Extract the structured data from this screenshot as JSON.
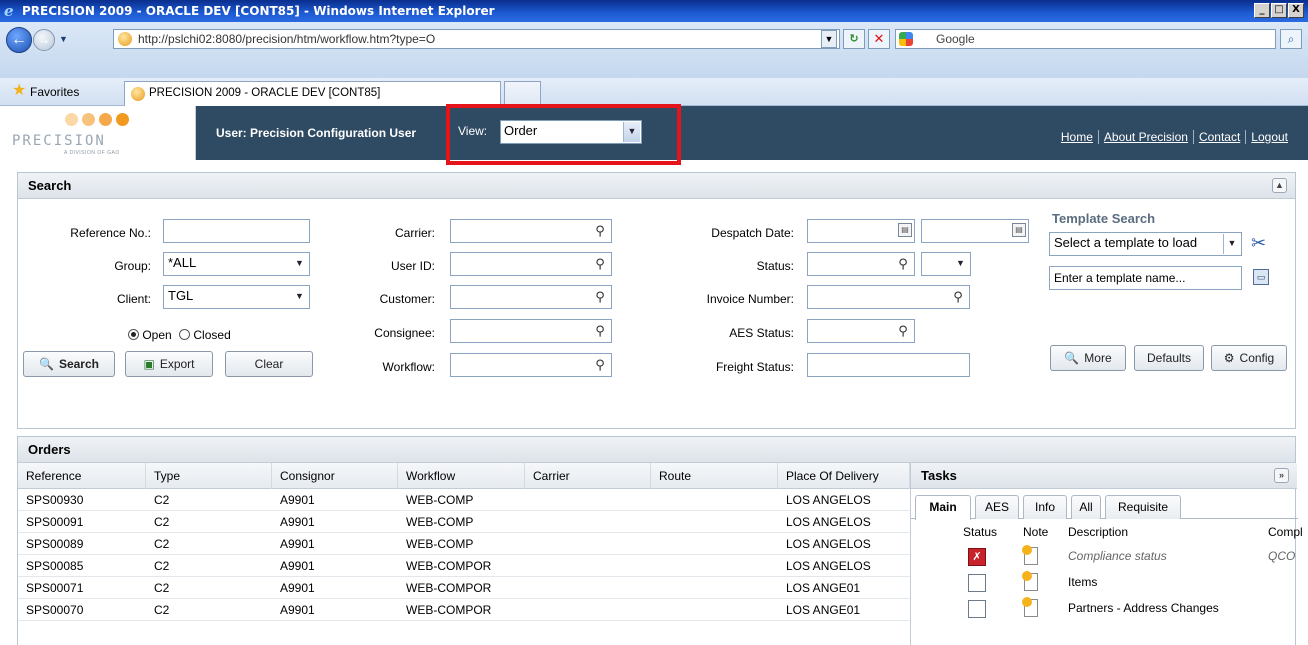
{
  "window": {
    "title": "PRECISION 2009 - ORACLE DEV [CONT85] - Windows Internet Explorer",
    "minimize": "_",
    "maximize": "□",
    "close": "X"
  },
  "browser": {
    "url": "http://pslchi02:8080/precision/htm/workflow.htm?type=O",
    "search_engine": "Google",
    "favorites_label": "Favorites",
    "tab_title": "PRECISION 2009 - ORACLE DEV [CONT85]"
  },
  "header": {
    "logo_text": "PRECISION",
    "logo_sub": "A DIVISION OF GAO",
    "user_label": "User: Precision Configuration User",
    "view_label": "View:",
    "view_value": "Order",
    "links": [
      "Home",
      "About Precision",
      "Contact",
      "Logout"
    ]
  },
  "search": {
    "title": "Search",
    "reference_label": "Reference No.:",
    "reference_value": "",
    "group_label": "Group:",
    "group_value": "*ALL",
    "client_label": "Client:",
    "client_value": "TGL",
    "open_label": "Open",
    "closed_label": "Closed",
    "carrier_label": "Carrier:",
    "userid_label": "User ID:",
    "customer_label": "Customer:",
    "consignee_label": "Consignee:",
    "workflow_label": "Workflow:",
    "despatch_label": "Despatch Date:",
    "status_label": "Status:",
    "invoice_label": "Invoice Number:",
    "aes_label": "AES Status:",
    "freight_label": "Freight Status:",
    "search_button": "Search",
    "export_button": "Export",
    "clear_button": "Clear",
    "template": {
      "title": "Template Search",
      "select_value": "Select a template to load",
      "name_placeholder": "Enter a template name...",
      "more_button": "More",
      "defaults_button": "Defaults",
      "config_button": "Config"
    }
  },
  "orders": {
    "title": "Orders",
    "columns": [
      "Reference",
      "Type",
      "Consignor",
      "Workflow",
      "Carrier",
      "Route",
      "Place Of Delivery"
    ],
    "rows": [
      [
        "SPS00930",
        "C2",
        "A9901",
        "WEB-COMP",
        "",
        "",
        "LOS ANGELOS"
      ],
      [
        "SPS00091",
        "C2",
        "A9901",
        "WEB-COMP",
        "",
        "",
        "LOS ANGELOS"
      ],
      [
        "SPS00089",
        "C2",
        "A9901",
        "WEB-COMP",
        "",
        "",
        "LOS ANGELOS"
      ],
      [
        "SPS00085",
        "C2",
        "A9901",
        "WEB-COMPOR",
        "",
        "",
        "LOS ANGELOS"
      ],
      [
        "SPS00071",
        "C2",
        "A9901",
        "WEB-COMPOR",
        "",
        "",
        "LOS ANGE01"
      ],
      [
        "SPS00070",
        "C2",
        "A9901",
        "WEB-COMPOR",
        "",
        "",
        "LOS ANGE01"
      ]
    ]
  },
  "tasks": {
    "title": "Tasks",
    "tabs": [
      "Main",
      "AES",
      "Info",
      "All",
      "Requisite"
    ],
    "columns": [
      "Status",
      "Note",
      "Description",
      "Compl"
    ],
    "rows": [
      {
        "description": "Compliance status",
        "compl": "QCO",
        "status": "fail"
      },
      {
        "description": "Items",
        "compl": "",
        "status": "empty"
      },
      {
        "description": "Partners - Address Changes",
        "compl": "",
        "status": "empty"
      }
    ]
  },
  "colors": {
    "header_bg": "#2f4a63",
    "highlight": "#e4141a",
    "logo_orange": "#f29a20"
  }
}
